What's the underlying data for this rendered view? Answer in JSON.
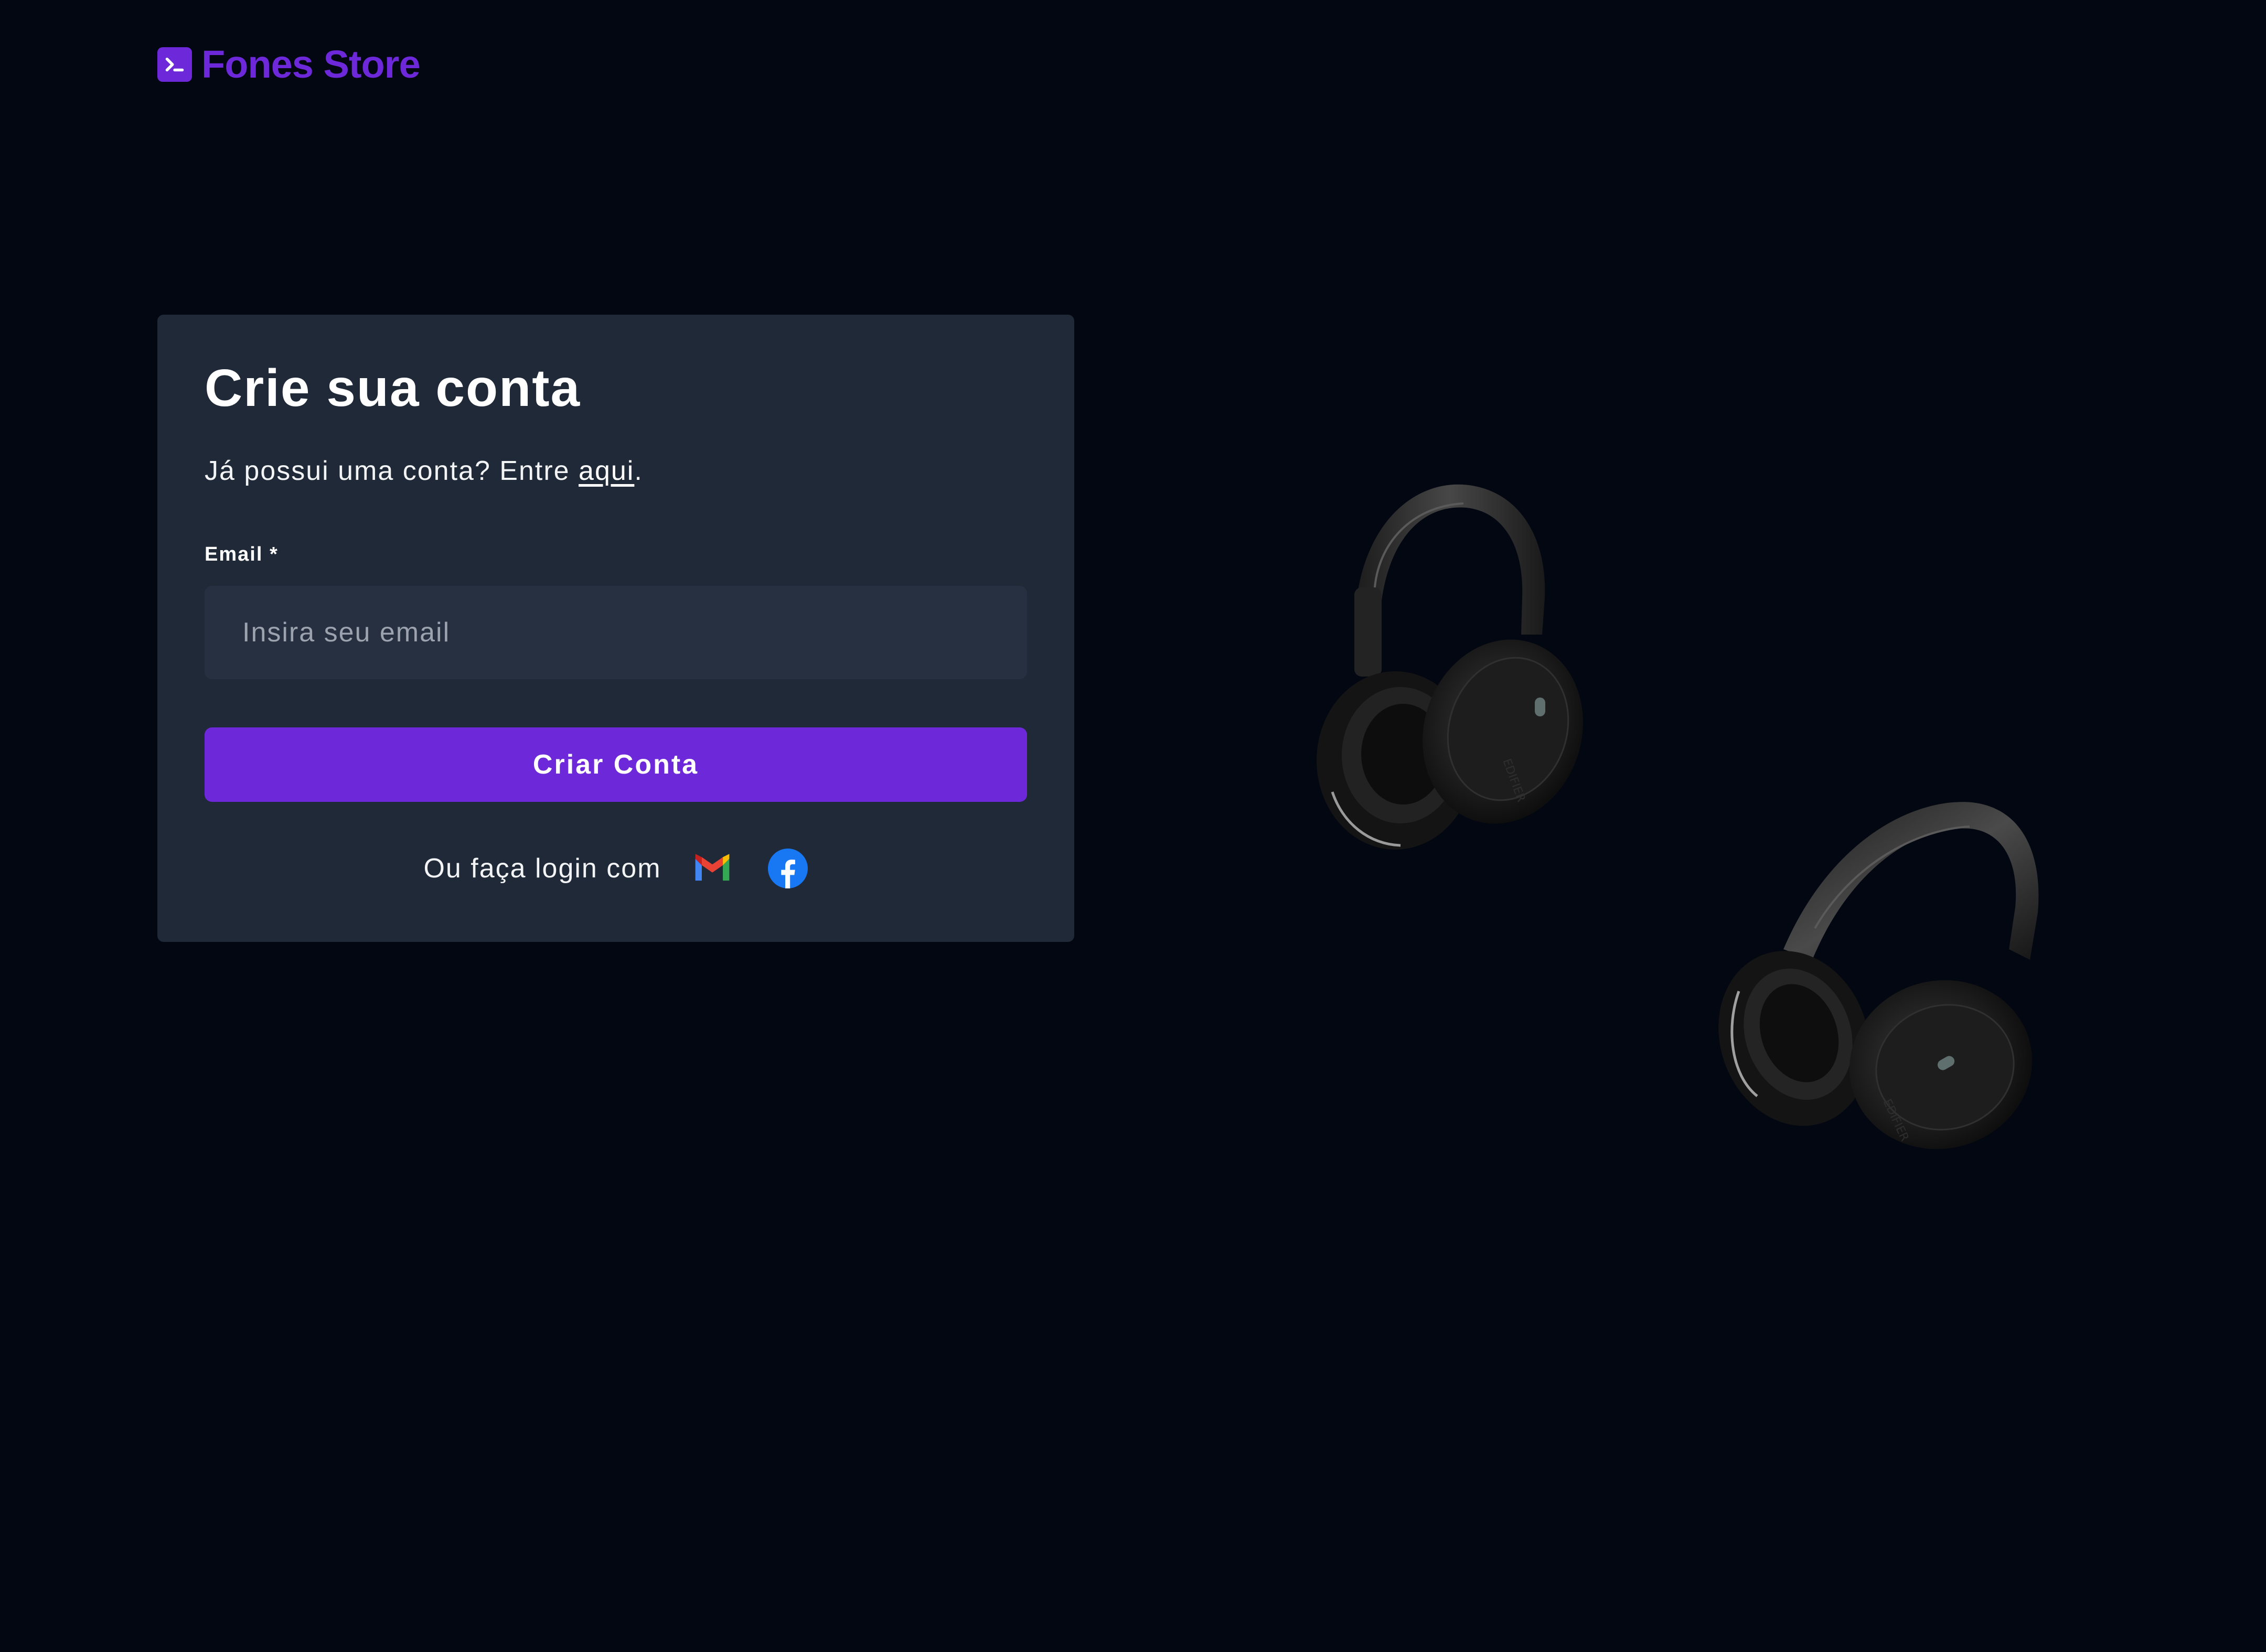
{
  "brand": {
    "name": "Fones Store",
    "color": "#6d28d9",
    "icon": "terminal-icon"
  },
  "signup": {
    "title": "Crie sua conta",
    "have_account_prefix": "Já possui uma conta? Entre ",
    "have_account_link": "aqui",
    "have_account_suffix": ".",
    "email_label": "Email *",
    "email_placeholder": "Insira seu email",
    "email_value": "",
    "submit_label": "Criar Conta",
    "social_text": "Ou faça login com",
    "social_icons": [
      "gmail-icon",
      "facebook-icon"
    ]
  },
  "hero": {
    "images": [
      "headphones-image",
      "headphones-image"
    ]
  },
  "colors": {
    "background": "#030712",
    "card": "#1f2937",
    "input": "#263040",
    "accent": "#6d28d9"
  }
}
